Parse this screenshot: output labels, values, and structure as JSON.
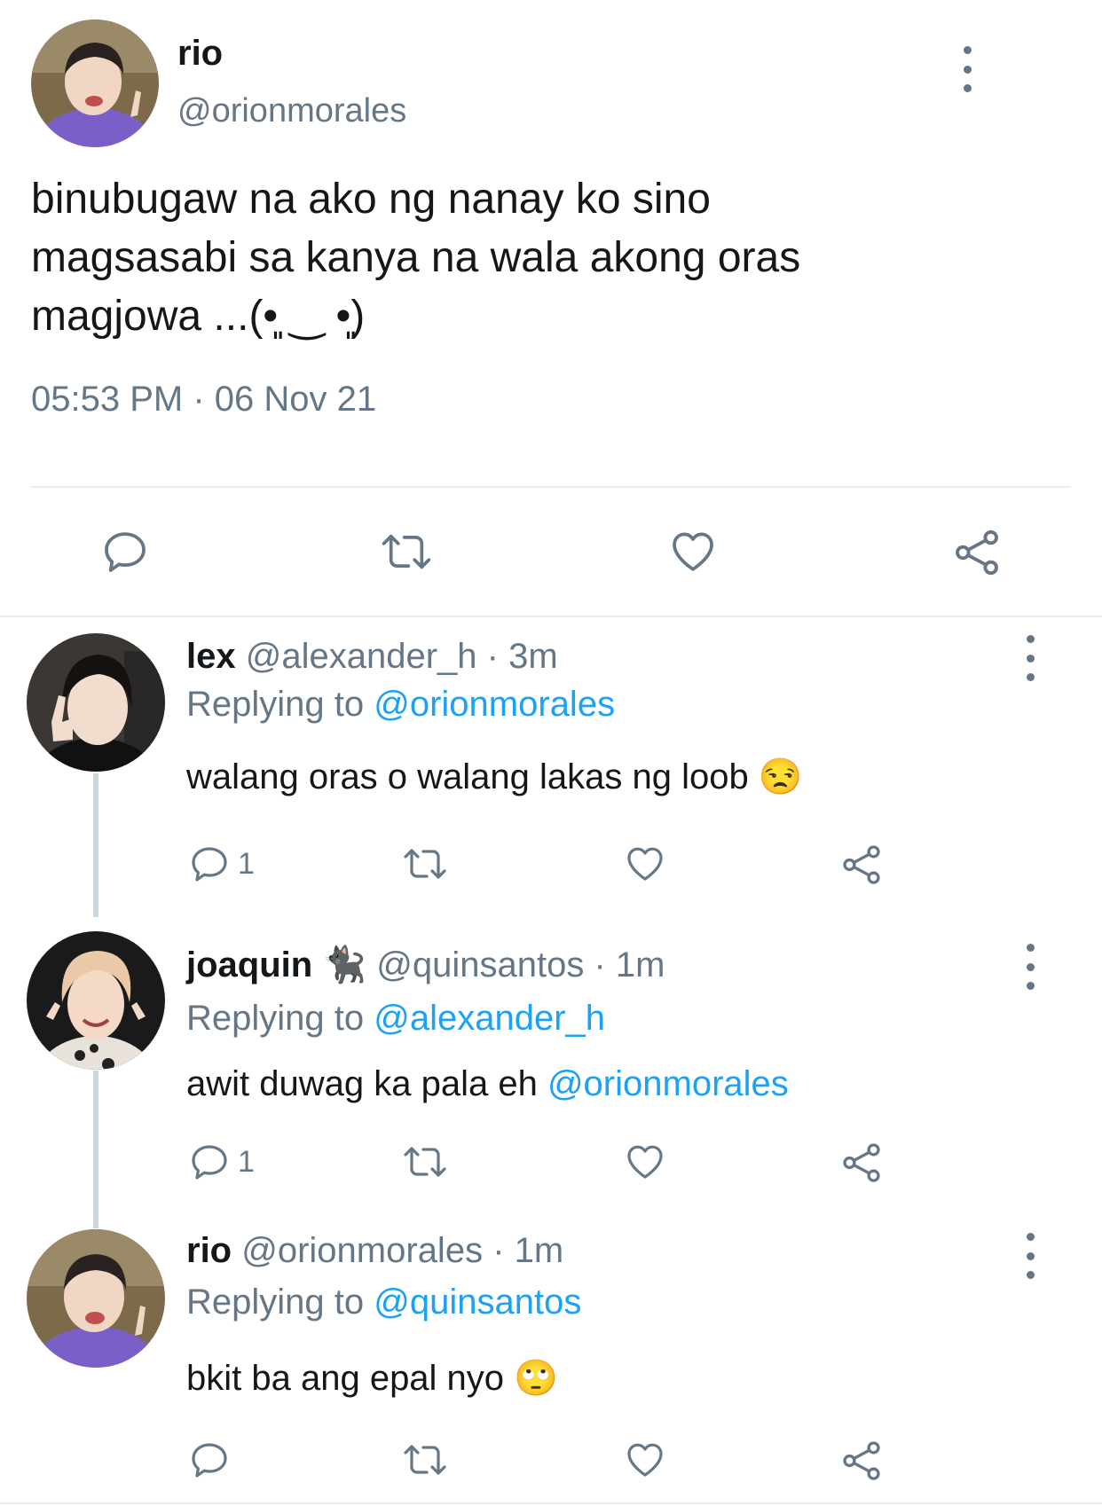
{
  "main_tweet": {
    "display_name": "rio",
    "handle": "@orionmorales",
    "text_line1": "binubugaw na ako ng nanay ko sino",
    "text_line2": "magsasabi sa kanya na wala akong oras",
    "text_line3": "magjowa ...(•͈ ‿ •͈)",
    "timestamp": "05:53 PM · 06 Nov 21"
  },
  "replies": [
    {
      "display_name": "lex",
      "handle": "@alexander_h",
      "time": "· 3m",
      "replying_prefix": "Replying to",
      "replying_to": "@orionmorales",
      "text": "walang oras o walang lakas ng loob",
      "emoji": "😒",
      "reply_count": "1"
    },
    {
      "display_name": "joaquin",
      "name_emoji": "🐈‍⬛",
      "handle": "@quinsantos",
      "time": "· 1m",
      "replying_prefix": "Replying to",
      "replying_to": "@alexander_h",
      "text": "awit duwag ka pala eh",
      "mention": "@orionmorales",
      "reply_count": "1"
    },
    {
      "display_name": "rio",
      "handle": "@orionmorales",
      "time": "· 1m",
      "replying_prefix": "Replying to",
      "replying_to": "@quinsantos",
      "text": "bkit ba ang epal nyo",
      "emoji": "🙄",
      "reply_count": ""
    }
  ],
  "icons": {
    "reply": "reply-icon",
    "retweet": "retweet-icon",
    "like": "heart-icon",
    "share": "share-icon",
    "more": "more-vertical-icon"
  },
  "colors": {
    "link": "#1da1f2",
    "muted": "#657786",
    "text": "#14171a",
    "thread_line": "#ccd6dd"
  }
}
